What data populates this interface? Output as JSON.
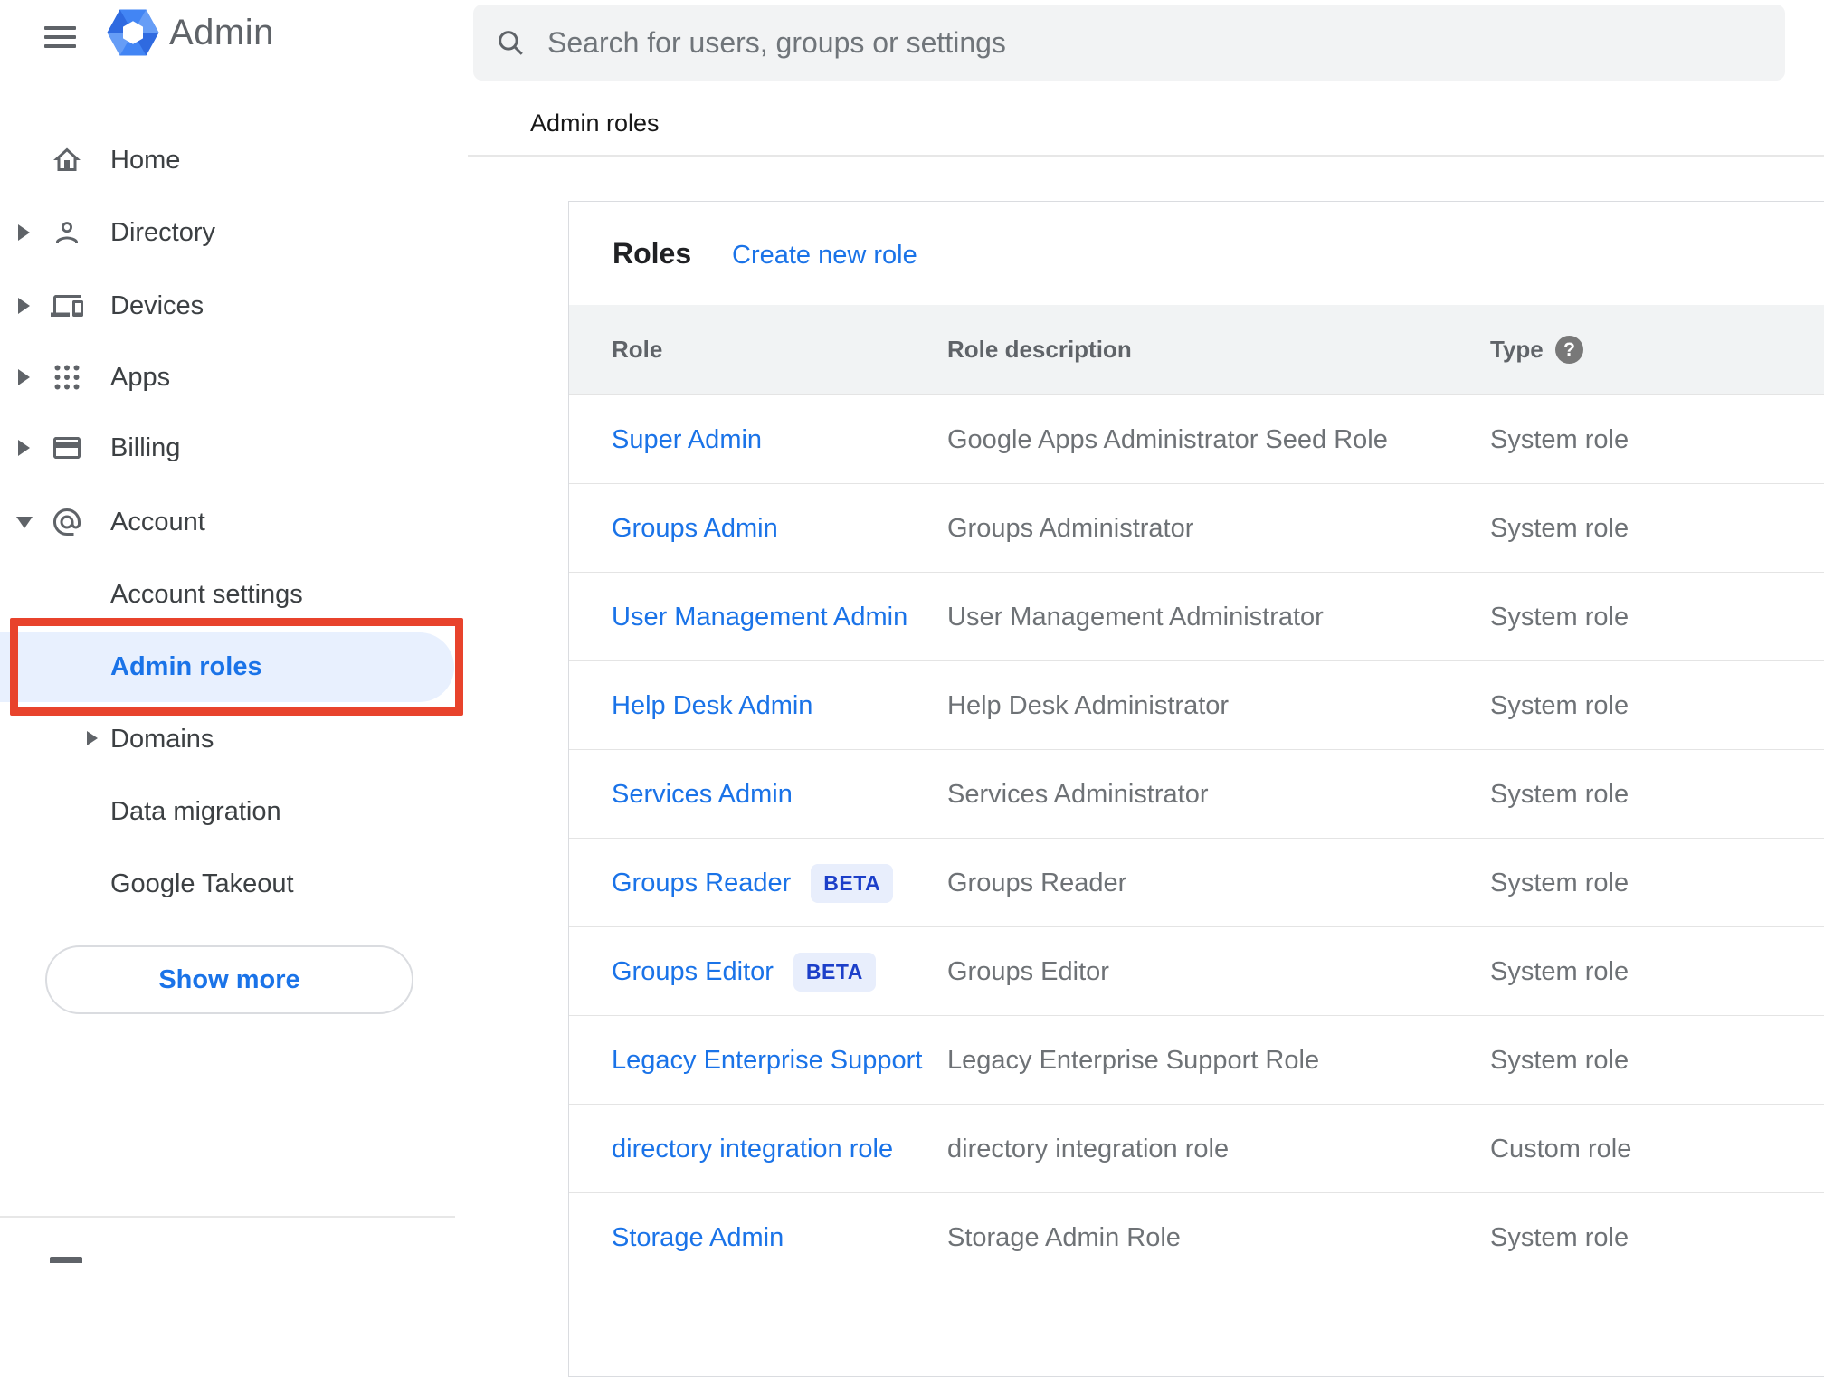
{
  "topbar": {
    "search_placeholder": "Search for users, groups or settings"
  },
  "logo": {
    "product": "Admin"
  },
  "sidebar": {
    "items": [
      {
        "label": "Home",
        "expandable": false
      },
      {
        "label": "Directory",
        "expandable": true
      },
      {
        "label": "Devices",
        "expandable": true
      },
      {
        "label": "Apps",
        "expandable": true
      },
      {
        "label": "Billing",
        "expandable": true
      },
      {
        "label": "Account",
        "expandable": true,
        "expanded": true
      }
    ],
    "account_children": [
      {
        "label": "Account settings",
        "selected": false
      },
      {
        "label": "Admin roles",
        "selected": true
      },
      {
        "label": "Domains",
        "expandable": true,
        "selected": false
      },
      {
        "label": "Data migration",
        "selected": false
      },
      {
        "label": "Google Takeout",
        "selected": false
      }
    ],
    "show_more_label": "Show more"
  },
  "breadcrumb": {
    "title": "Admin roles"
  },
  "roles_card": {
    "title": "Roles",
    "create_link": "Create new role",
    "columns": {
      "role": "Role",
      "description": "Role description",
      "type": "Type",
      "type_help_glyph": "?"
    },
    "rows": [
      {
        "role": "Super Admin",
        "description": "Google Apps Administrator Seed Role",
        "type": "System role"
      },
      {
        "role": "Groups Admin",
        "description": "Groups Administrator",
        "type": "System role"
      },
      {
        "role": "User Management Admin",
        "description": "User Management Administrator",
        "type": "System role"
      },
      {
        "role": "Help Desk Admin",
        "description": "Help Desk Administrator",
        "type": "System role"
      },
      {
        "role": "Services Admin",
        "description": "Services Administrator",
        "type": "System role"
      },
      {
        "role": "Groups Reader",
        "badge": "BETA",
        "description": "Groups Reader",
        "type": "System role"
      },
      {
        "role": "Groups Editor",
        "badge": "BETA",
        "description": "Groups Editor",
        "type": "System role"
      },
      {
        "role": "Legacy Enterprise Support",
        "description": "Legacy Enterprise Support Role",
        "type": "System role"
      },
      {
        "role": "directory integration role",
        "description": "directory integration role",
        "type": "Custom role"
      },
      {
        "role": "Storage Admin",
        "description": "Storage Admin Role",
        "type": "System role"
      }
    ]
  },
  "colors": {
    "accent_blue": "#1a73e8",
    "selected_item_bg": "#e8f0fe",
    "highlight_box_red": "#e8432c",
    "table_header_bg": "#f1f3f4",
    "beta_badge_bg": "#e8eefc",
    "beta_badge_text": "#1c3fc9",
    "icon_gray": "#5f6368"
  }
}
